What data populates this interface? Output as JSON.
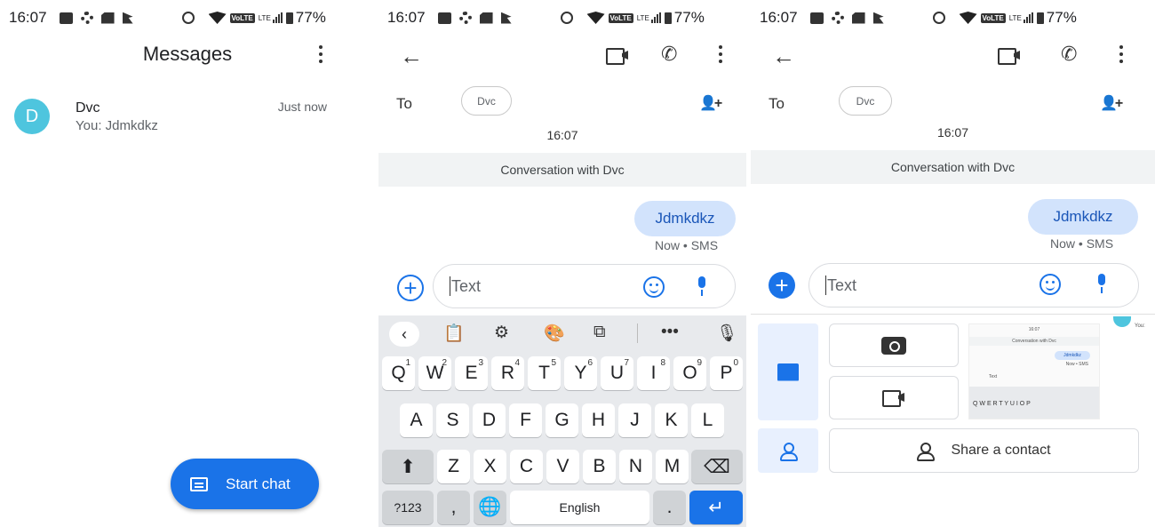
{
  "status": {
    "time": "16:07",
    "volte": "VoLTE",
    "lte": "LTE",
    "battery": "77%"
  },
  "list_screen": {
    "title": "Messages",
    "conversation": {
      "avatar_letter": "D",
      "name": "Dvc",
      "snippet": "You: Jdmkdkz",
      "time": "Just now"
    },
    "fab_label": "Start chat"
  },
  "thread_screen": {
    "to_label": "To",
    "recipient_chip": "Dvc",
    "timestamp": "16:07",
    "banner": "Conversation with Dvc",
    "message": "Jdmkdkz",
    "message_meta": "Now • SMS",
    "compose_placeholder": "Text"
  },
  "keyboard": {
    "row1": [
      {
        "k": "Q",
        "n": "1"
      },
      {
        "k": "W",
        "n": "2"
      },
      {
        "k": "E",
        "n": "3"
      },
      {
        "k": "R",
        "n": "4"
      },
      {
        "k": "T",
        "n": "5"
      },
      {
        "k": "Y",
        "n": "6"
      },
      {
        "k": "U",
        "n": "7"
      },
      {
        "k": "I",
        "n": "8"
      },
      {
        "k": "O",
        "n": "9"
      },
      {
        "k": "P",
        "n": "0"
      }
    ],
    "row2": [
      "A",
      "S",
      "D",
      "F",
      "G",
      "H",
      "J",
      "K",
      "L"
    ],
    "row3": [
      "Z",
      "X",
      "C",
      "V",
      "B",
      "N",
      "M"
    ],
    "symbols_key": "?123",
    "comma_key": ",",
    "space_label": "English",
    "period_key": "."
  },
  "attach_screen": {
    "share_contact_label": "Share a contact",
    "thumbnail": {
      "time": "16:07",
      "banner": "Conversation with Dvc",
      "message": "Jdmkdkz",
      "meta": "Now • SMS",
      "compose": "Text",
      "keys": "Q W E R T Y U I O P",
      "you": "You:"
    }
  },
  "colors": {
    "accent": "#1a73e8",
    "bubble": "#d2e3fc",
    "avatar": "#4ec5de"
  },
  "icons": [
    "back-arrow-icon",
    "video-call-icon",
    "phone-icon",
    "more-vert-icon",
    "add-people-icon",
    "emoji-icon",
    "mic-icon",
    "camera-icon",
    "gallery-icon",
    "person-icon"
  ]
}
